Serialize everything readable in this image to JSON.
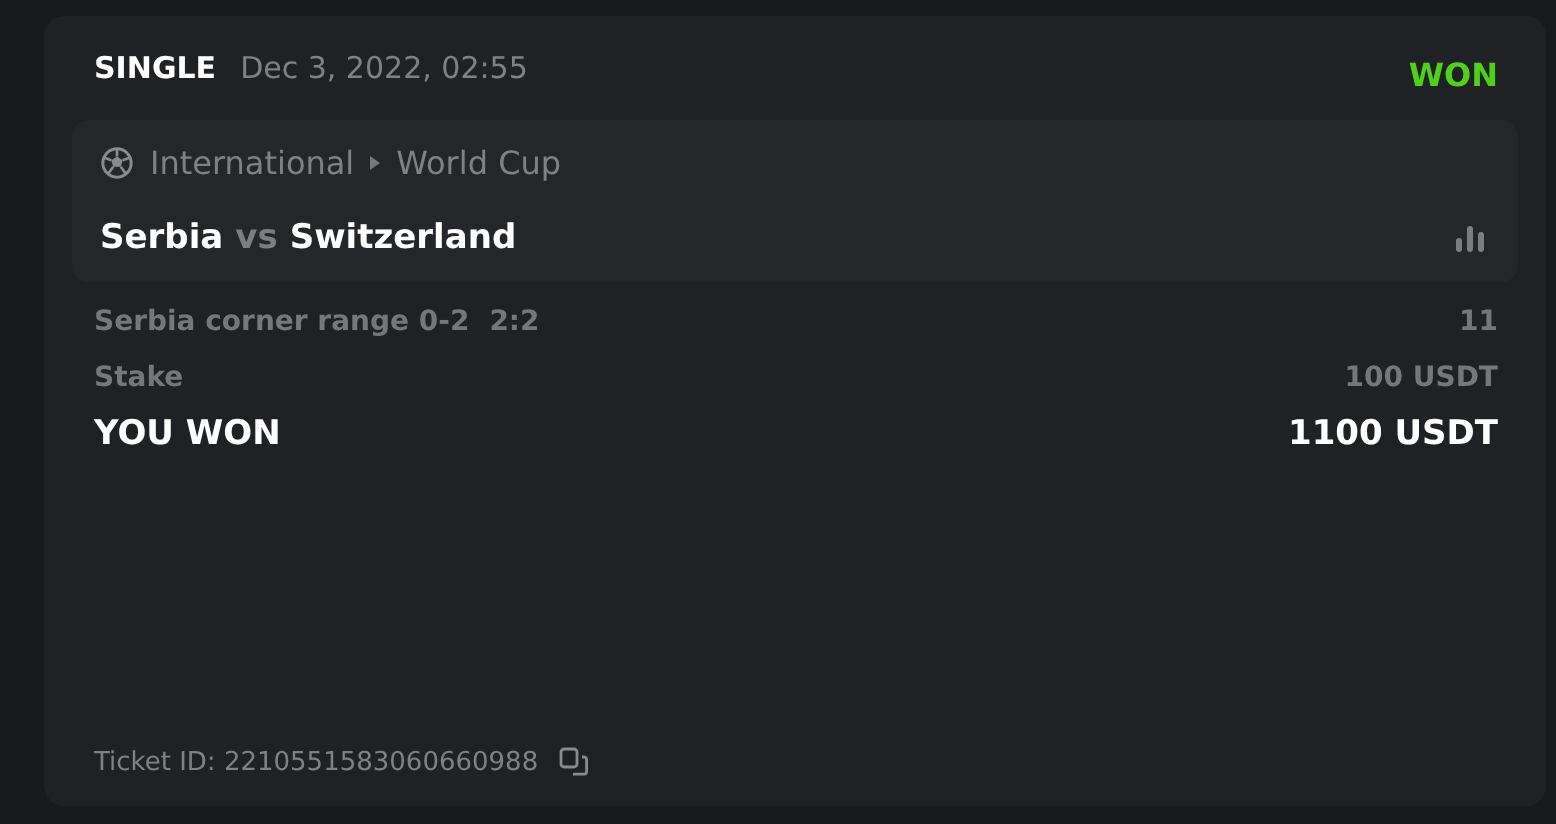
{
  "ticket": {
    "type": "SINGLE",
    "date": "Dec 3, 2022, 02:55",
    "status": {
      "label": "WON",
      "kind": "won"
    },
    "event": {
      "category": "International",
      "league": "World Cup",
      "home": "Serbia",
      "vs": "vs",
      "away": "Switzerland"
    },
    "selection": {
      "market": "Serbia corner range 0-2",
      "score": "2:2",
      "odds": "11"
    },
    "stake": {
      "label": "Stake",
      "value": "100 USDT"
    },
    "result": {
      "label": "YOU WON",
      "value": "1100 USDT"
    },
    "ticket_id": "Ticket ID: 2210551583060660988"
  }
}
